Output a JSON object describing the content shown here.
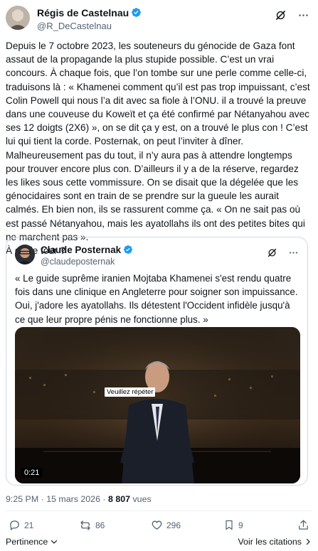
{
  "author": {
    "name": "Régis de Castelnau",
    "handle": "@R_DeCastelnau"
  },
  "tweet": {
    "text": "Depuis le 7 octobre 2023, les souteneurs du génocide de Gaza font assaut de la propagande la plus stupide possible. C’est un vrai concours. À chaque fois, que l’on tombe sur une perle comme celle-ci, traduisons là : « Khamenei comment qu’il est pas trop impuissant, c’est Colin Powell qui nous l’a dit avec sa fiole à l’ONU. il a trouvé la preuve dans une couveuse du Koweït et ça été confirmé par Nétanyahou avec ses 12 doigts (2X6) », on se dit ça y est, on a trouvé le plus con ! C’est lui qui tient la corde. Posternak, on peut l’inviter à dîner. Malheureusement pas du tout, il n’y aura pas à attendre longtemps pour trouver encore plus con. D’ailleurs il y a de la réserve, regardez les likes sous cette vommissure. On se disait que la dégelée que les génocidaires sont en train de se prendre sur la gueule les aurait calmés. Eh bien non, ils se rassurent comme ça. « On ne sait pas où est passé Nétanyahou, mais les ayatollahs ils ont des petites bites qui ne marchent pas ».\nÀ qui le tour ?"
  },
  "quote": {
    "name": "Claude Posternak",
    "handle": "@claudeposternak",
    "text": "« Le guide suprême iranien Mojtaba Khamenei s'est rendu quatre fois dans une clinique en Angleterre pour soigner son impuissance. Oui, j'adore les ayatollahs. Ils détestent l'Occident infidèle jusqu'à ce que leur propre pénis ne fonctionne plus. »",
    "video_caption": "Veuillez répéter",
    "video_duration": "0:21"
  },
  "meta": {
    "time": "9:25 PM",
    "separator": "·",
    "date": "15 mars 2026",
    "views_count": "8 807",
    "views_label": "vues"
  },
  "actions": {
    "replies": "21",
    "reposts": "86",
    "likes": "296",
    "bookmarks": "9"
  },
  "footer": {
    "relevance_label": "Pertinence",
    "quotes_label": "Voir les citations"
  },
  "colors": {
    "verified": "#1d9bf0",
    "muted": "#536471",
    "text": "#0f1419",
    "border": "#cfd9de"
  },
  "icons": [
    "verified-badge-icon",
    "grok-icon",
    "more-icon",
    "reply-icon",
    "repost-icon",
    "like-icon",
    "bookmark-icon",
    "share-icon",
    "chevron-down-icon",
    "chevron-right-icon"
  ]
}
